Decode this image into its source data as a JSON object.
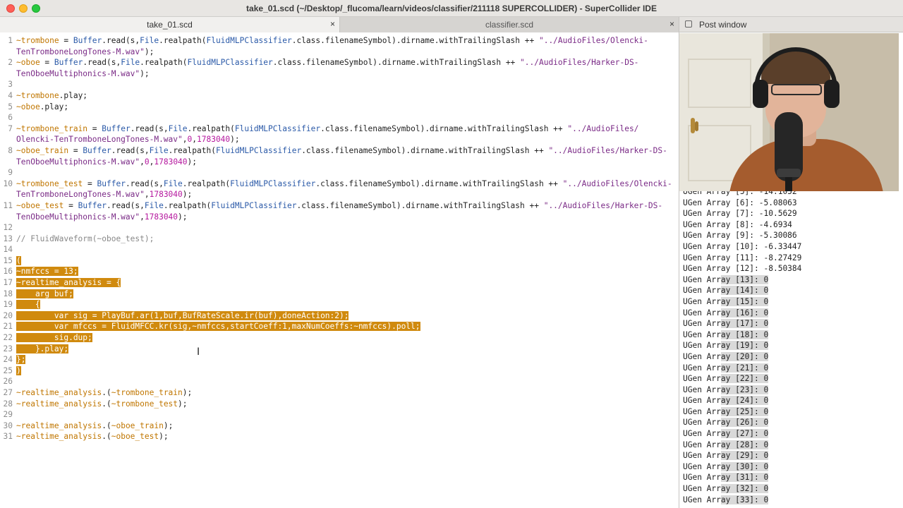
{
  "window": {
    "title": "take_01.scd (~/Desktop/_flucoma/learn/videos/classifier/211118 SUPERCOLLIDER) - SuperCollider IDE"
  },
  "tabs": [
    {
      "label": "take_01.scd",
      "close": "×"
    },
    {
      "label": "classifier.scd",
      "close": "×"
    }
  ],
  "post_window": {
    "title": "Post window",
    "lines": [
      "UGen Array [5]: -14.1052",
      "UGen Array [6]: -5.08063",
      "UGen Array [7]: -10.5629",
      "UGen Array [8]: -4.6934",
      "UGen Array [9]: -5.30086",
      "UGen Array [10]: -6.33447",
      "UGen Array [11]: -8.27429",
      "UGen Array [12]: -8.50384",
      "UGen Array [13]: 0",
      "UGen Array [14]: 0",
      "UGen Array [15]: 0",
      "UGen Array [16]: 0",
      "UGen Array [17]: 0",
      "UGen Array [18]: 0",
      "UGen Array [19]: 0",
      "UGen Array [20]: 0",
      "UGen Array [21]: 0",
      "UGen Array [22]: 0",
      "UGen Array [23]: 0",
      "UGen Array [24]: 0",
      "UGen Array [25]: 0",
      "UGen Array [26]: 0",
      "UGen Array [27]: 0",
      "UGen Array [28]: 0",
      "UGen Array [29]: 0",
      "UGen Array [30]: 0",
      "UGen Array [31]: 0",
      "UGen Array [32]: 0",
      "UGen Array [33]: 0"
    ]
  },
  "editor": {
    "line_numbers": [
      "1",
      "",
      "2",
      "",
      "3",
      "4",
      "5",
      "6",
      "7",
      "",
      "8",
      "",
      "9",
      "10",
      "",
      "11",
      "",
      "12",
      "13",
      "14",
      "15",
      "16",
      "17",
      "18",
      "19",
      "20",
      "21",
      "22",
      "23",
      "24",
      "25",
      "26",
      "27",
      "28",
      "29",
      "30",
      "31"
    ],
    "lines": [
      [
        {
          "t": "~trombone",
          "c": "e"
        },
        {
          "t": " = "
        },
        {
          "t": "Buffer",
          "c": "k"
        },
        {
          "t": ".read(s,"
        },
        {
          "t": "File",
          "c": "k"
        },
        {
          "t": ".realpath("
        },
        {
          "t": "FluidMLPClassifier",
          "c": "k"
        },
        {
          "t": ".class.filenameSymbol).dirname.withTrailingSlash ++ "
        },
        {
          "t": "\"../AudioFiles/Olencki-",
          "c": "s"
        }
      ],
      [
        {
          "t": "TenTromboneLongTones-M.wav\"",
          "c": "s"
        },
        {
          "t": ");"
        }
      ],
      [
        {
          "t": "~oboe",
          "c": "e"
        },
        {
          "t": " = "
        },
        {
          "t": "Buffer",
          "c": "k"
        },
        {
          "t": ".read(s,"
        },
        {
          "t": "File",
          "c": "k"
        },
        {
          "t": ".realpath("
        },
        {
          "t": "FluidMLPClassifier",
          "c": "k"
        },
        {
          "t": ".class.filenameSymbol).dirname.withTrailingSlash ++ "
        },
        {
          "t": "\"../AudioFiles/Harker-DS-",
          "c": "s"
        }
      ],
      [
        {
          "t": "TenOboeMultiphonics-M.wav\"",
          "c": "s"
        },
        {
          "t": ");"
        }
      ],
      [],
      [
        {
          "t": "~trombone",
          "c": "e"
        },
        {
          "t": ".play;"
        }
      ],
      [
        {
          "t": "~oboe",
          "c": "e"
        },
        {
          "t": ".play;"
        }
      ],
      [],
      [
        {
          "t": "~trombone_train",
          "c": "e"
        },
        {
          "t": " = "
        },
        {
          "t": "Buffer",
          "c": "k"
        },
        {
          "t": ".read(s,"
        },
        {
          "t": "File",
          "c": "k"
        },
        {
          "t": ".realpath("
        },
        {
          "t": "FluidMLPClassifier",
          "c": "k"
        },
        {
          "t": ".class.filenameSymbol).dirname.withTrailingSlash ++ "
        },
        {
          "t": "\"../AudioFiles/",
          "c": "s"
        }
      ],
      [
        {
          "t": "Olencki-TenTromboneLongTones-M.wav\"",
          "c": "s"
        },
        {
          "t": ","
        },
        {
          "t": "0",
          "c": "n"
        },
        {
          "t": ","
        },
        {
          "t": "1783040",
          "c": "n"
        },
        {
          "t": ");"
        }
      ],
      [
        {
          "t": "~oboe_train",
          "c": "e"
        },
        {
          "t": " = "
        },
        {
          "t": "Buffer",
          "c": "k"
        },
        {
          "t": ".read(s,"
        },
        {
          "t": "File",
          "c": "k"
        },
        {
          "t": ".realpath("
        },
        {
          "t": "FluidMLPClassifier",
          "c": "k"
        },
        {
          "t": ".class.filenameSymbol).dirname.withTrailingSlash ++ "
        },
        {
          "t": "\"../AudioFiles/Harker-DS-",
          "c": "s"
        }
      ],
      [
        {
          "t": "TenOboeMultiphonics-M.wav\"",
          "c": "s"
        },
        {
          "t": ","
        },
        {
          "t": "0",
          "c": "n"
        },
        {
          "t": ","
        },
        {
          "t": "1783040",
          "c": "n"
        },
        {
          "t": ");"
        }
      ],
      [],
      [
        {
          "t": "~trombone_test",
          "c": "e"
        },
        {
          "t": " = "
        },
        {
          "t": "Buffer",
          "c": "k"
        },
        {
          "t": ".read(s,"
        },
        {
          "t": "File",
          "c": "k"
        },
        {
          "t": ".realpath("
        },
        {
          "t": "FluidMLPClassifier",
          "c": "k"
        },
        {
          "t": ".class.filenameSymbol).dirname.withTrailingSlash ++ "
        },
        {
          "t": "\"../AudioFiles/Olencki-",
          "c": "s"
        }
      ],
      [
        {
          "t": "TenTromboneLongTones-M.wav\"",
          "c": "s"
        },
        {
          "t": ","
        },
        {
          "t": "1783040",
          "c": "n"
        },
        {
          "t": ");"
        }
      ],
      [
        {
          "t": "~oboe_test",
          "c": "e"
        },
        {
          "t": " = "
        },
        {
          "t": "Buffer",
          "c": "k"
        },
        {
          "t": ".read(s,"
        },
        {
          "t": "File",
          "c": "k"
        },
        {
          "t": ".realpath("
        },
        {
          "t": "FluidMLPClassifier",
          "c": "k"
        },
        {
          "t": ".class.filenameSymbol).dirname.withTrailingSlash ++ "
        },
        {
          "t": "\"../AudioFiles/Harker-DS-",
          "c": "s"
        }
      ],
      [
        {
          "t": "TenOboeMultiphonics-M.wav\"",
          "c": "s"
        },
        {
          "t": ","
        },
        {
          "t": "1783040",
          "c": "n"
        },
        {
          "t": ");"
        }
      ],
      [],
      [
        {
          "t": "// FluidWaveform(~oboe_test);",
          "c": "c"
        }
      ],
      [],
      [
        {
          "t": "(",
          "c": "sel"
        }
      ],
      [
        {
          "t": "~nmfccs = 13;",
          "c": "sel"
        }
      ],
      [
        {
          "t": "~realtime_analysis = {",
          "c": "sel"
        }
      ],
      [
        {
          "t": "    arg buf;",
          "c": "sel"
        }
      ],
      [
        {
          "t": "    {",
          "c": "sel"
        }
      ],
      [
        {
          "t": "        var sig = PlayBuf.ar(1,buf,BufRateScale.ir(buf),doneAction:2);",
          "c": "sel"
        }
      ],
      [
        {
          "t": "        var mfccs = FluidMFCC.kr(sig,~nmfccs,startCoeff:1,maxNumCoeffs:~nmfccs).poll;",
          "c": "sel"
        }
      ],
      [
        {
          "t": "        sig.dup;",
          "c": "sel"
        }
      ],
      [
        {
          "t": "    }.play;",
          "c": "sel"
        }
      ],
      [
        {
          "t": "};",
          "c": "sel"
        }
      ],
      [
        {
          "t": ")",
          "c": "sel"
        }
      ],
      [],
      [
        {
          "t": "~realtime_analysis",
          "c": "e"
        },
        {
          "t": ".("
        },
        {
          "t": "~trombone_train",
          "c": "e"
        },
        {
          "t": ");"
        }
      ],
      [
        {
          "t": "~realtime_analysis",
          "c": "e"
        },
        {
          "t": ".("
        },
        {
          "t": "~trombone_test",
          "c": "e"
        },
        {
          "t": ");"
        }
      ],
      [],
      [
        {
          "t": "~realtime_analysis",
          "c": "e"
        },
        {
          "t": ".("
        },
        {
          "t": "~oboe_train",
          "c": "e"
        },
        {
          "t": ");"
        }
      ],
      [
        {
          "t": "~realtime_analysis",
          "c": "e"
        },
        {
          "t": ".("
        },
        {
          "t": "~oboe_test",
          "c": "e"
        },
        {
          "t": ");"
        }
      ]
    ]
  },
  "colors": {
    "environment_var": "#c07600",
    "class_name": "#2b5aa8",
    "string": "#7a2a86",
    "number": "#b5179e",
    "comment": "#888888",
    "selection": "#d08a0e"
  }
}
